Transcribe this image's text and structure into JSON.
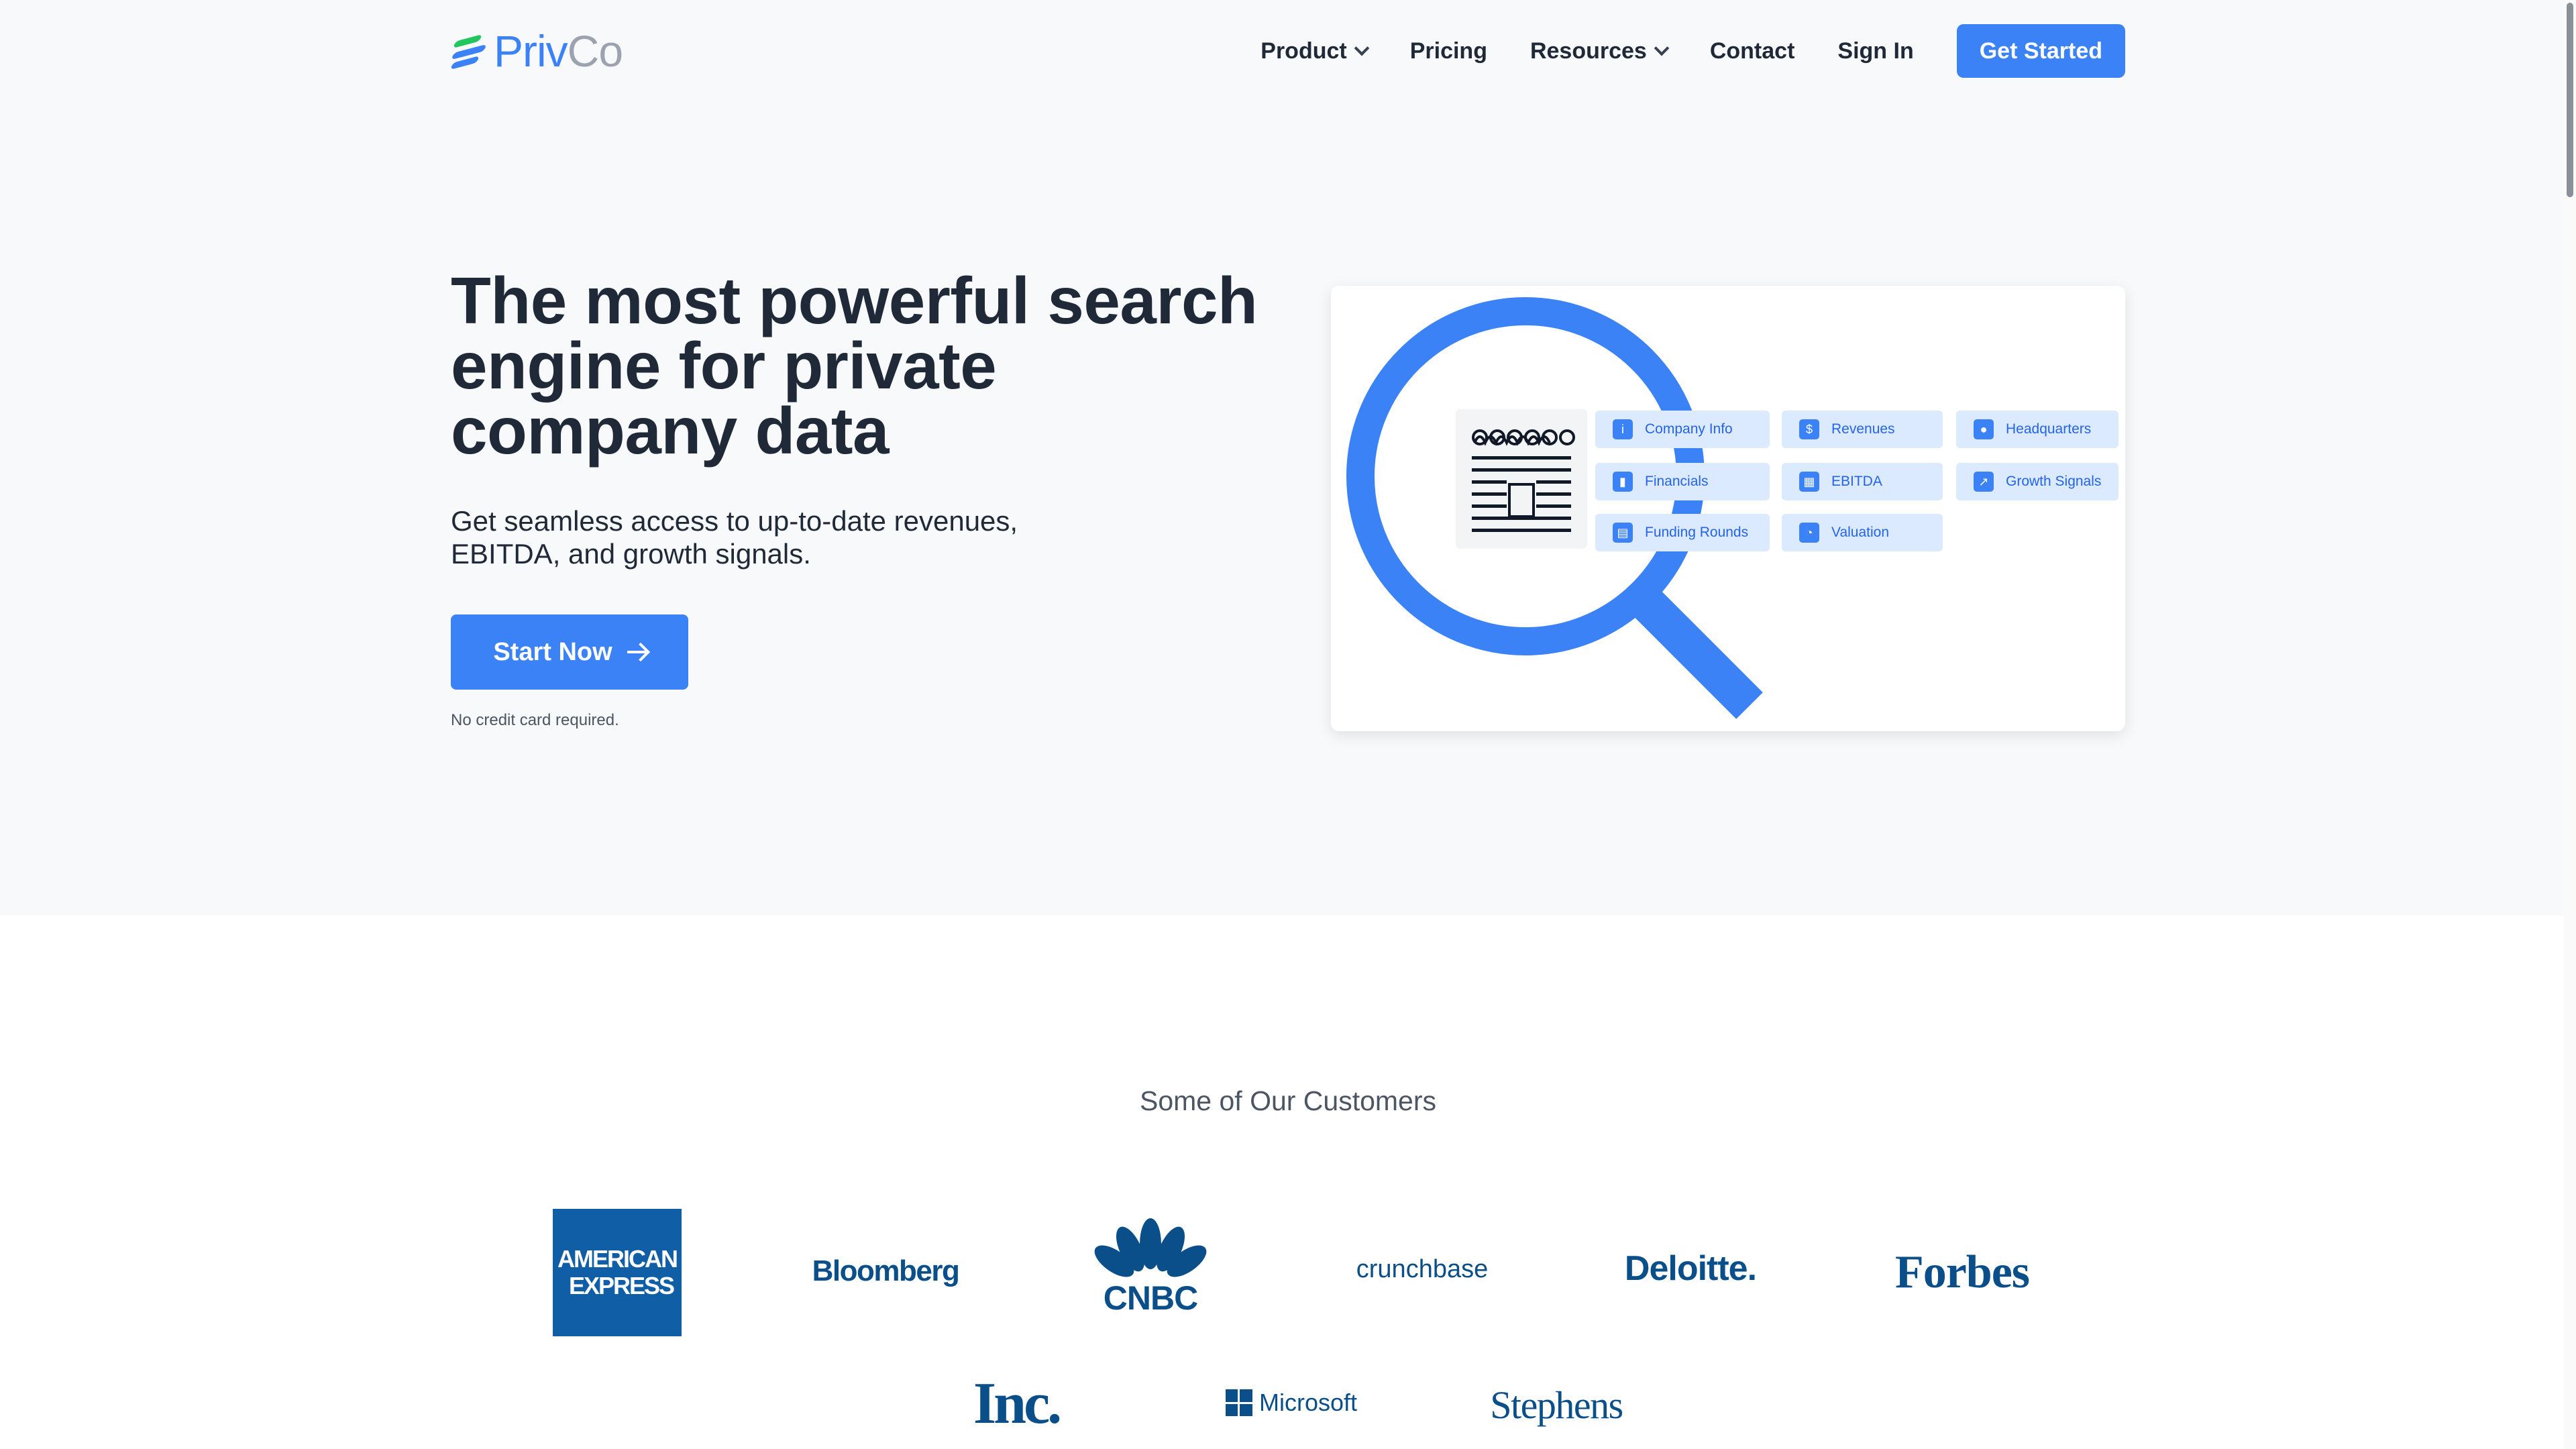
{
  "header": {
    "logo_priv": "Priv",
    "logo_co": "Co",
    "nav": [
      "Product",
      "Pricing",
      "Resources",
      "Contact",
      "Sign In"
    ],
    "cta": "Get Started"
  },
  "hero": {
    "title": "The most powerful search engine for private company data",
    "subtitle": "Get seamless access to up-to-date revenues, EBITDA, and growth signals.",
    "button": "Start Now",
    "note": "No credit card required."
  },
  "illustration": {
    "chips": [
      {
        "label": "Company Info",
        "icon": "info-icon"
      },
      {
        "label": "Revenues",
        "icon": "dollar-icon"
      },
      {
        "label": "Headquarters",
        "icon": "location-pin-icon"
      },
      {
        "label": "Financials",
        "icon": "bar-chart-icon"
      },
      {
        "label": "EBITDA",
        "icon": "calculator-icon"
      },
      {
        "label": "Growth Signals",
        "icon": "trend-up-icon"
      },
      {
        "label": "Funding Rounds",
        "icon": "calendar-icon"
      },
      {
        "label": "Valuation",
        "icon": "pie-chart-icon"
      }
    ],
    "colors": {
      "accent": "#3b82f6",
      "chip_bg": "#dbeafe"
    }
  },
  "customers": {
    "title": "Some of Our Customers",
    "logos": {
      "amex_line1": "AMERICAN",
      "amex_line2": "EXPRESS",
      "bloomberg": "Bloomberg",
      "cnbc": "CNBC",
      "crunchbase": "crunchbase",
      "deloitte": "Deloitte.",
      "forbes": "Forbes",
      "inc": "Inc.",
      "microsoft": "Microsoft",
      "stephens": "Stephens"
    }
  }
}
